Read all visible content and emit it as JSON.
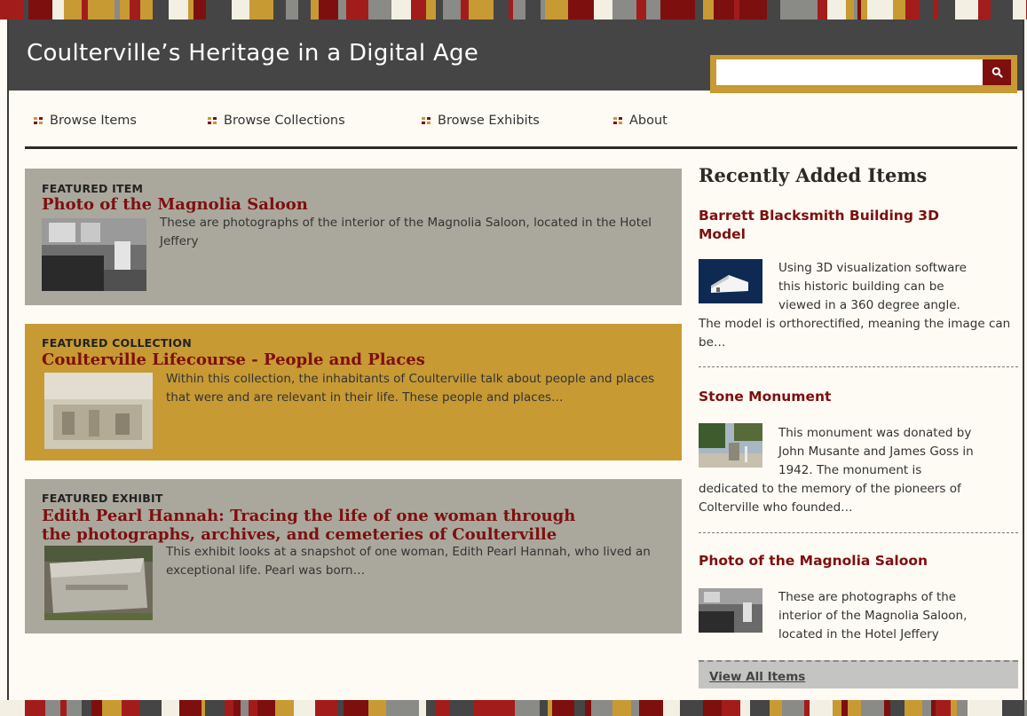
{
  "site": {
    "title": "Coulterville’s Heritage in a Digital Age",
    "colors": {
      "header": "#444544",
      "accent_gold": "#c79a34",
      "accent_red": "#7d0f0f",
      "panel_gray": "#aaa89c"
    }
  },
  "search": {
    "placeholder": "",
    "value": "",
    "button_icon": "search-icon"
  },
  "nav": {
    "items": [
      {
        "label": "Browse Items"
      },
      {
        "label": "Browse Collections"
      },
      {
        "label": "Browse Exhibits"
      },
      {
        "label": "About"
      }
    ]
  },
  "featured": {
    "item": {
      "heading": "FEATURED ITEM",
      "title": "Photo of the Magnolia Saloon",
      "text": "These are photographs of the interior of the Magnolia Saloon, located in the Hotel Jeffery"
    },
    "collection": {
      "heading": "FEATURED COLLECTION",
      "title": "Coulterville Lifecourse - People and Places",
      "text": "Within this collection, the inhabitants of Coulterville talk about people and places that were and are relevant in their life. These people and places…"
    },
    "exhibit": {
      "heading": "FEATURED EXHIBIT",
      "title_line1": "Edith Pearl Hannah: Tracing the life of one woman through",
      "title_line2": "the photographs, archives, and cemeteries of Coulterville",
      "text": "This exhibit looks at a snapshot of one woman, Edith Pearl Hannah, who lived an exceptional life. Pearl was born…"
    }
  },
  "recent": {
    "heading": "Recently Added Items",
    "items": [
      {
        "title_line1": "Barrett Blacksmith Building 3D",
        "title_line2": "Model",
        "text_lines": [
          "Using 3D visualization software",
          "this historic building can be",
          "viewed in a 360 degree angle."
        ],
        "text_rest": "The model is orthorectified, meaning the image can be…"
      },
      {
        "title_line1": "Stone Monument",
        "text_lines": [
          "This monument was donated by",
          "John Musante and James Goss in",
          "1942. The monument is"
        ],
        "text_rest": "dedicated to the memory of the pioneers of Colterville who founded…"
      },
      {
        "title_line1": "Photo of the Magnolia Saloon",
        "text_lines": [
          "These are photographs of the",
          "interior of the Magnolia Saloon,",
          "located in the Hotel Jeffery"
        ],
        "text_rest": ""
      }
    ],
    "view_all": "View All Items"
  }
}
